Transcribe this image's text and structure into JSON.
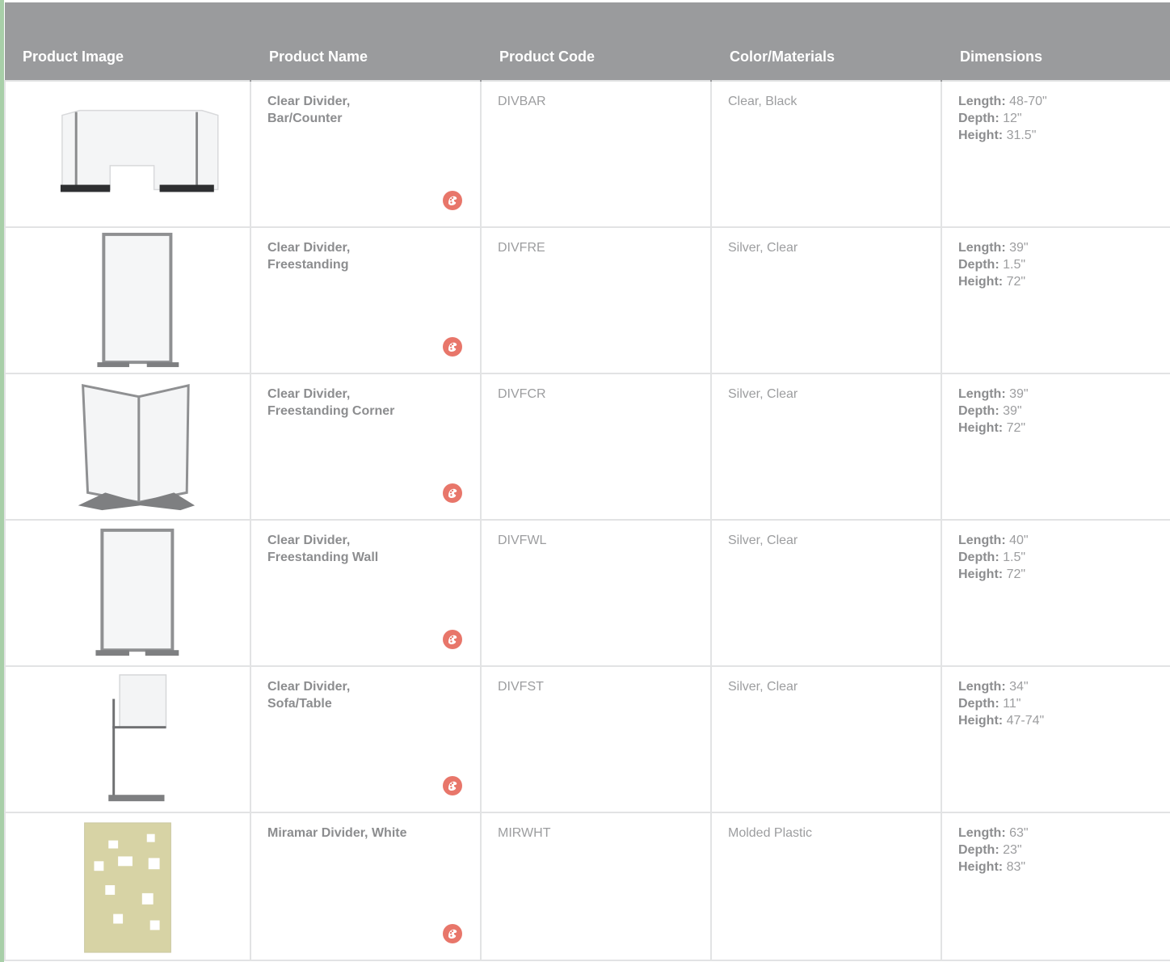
{
  "table": {
    "headers": [
      "Product Image",
      "Product Name",
      "Product Code",
      "Color/Materials",
      "Dimensions"
    ],
    "dim_labels": {
      "length": "Length:",
      "depth": "Depth:",
      "height": "Height:"
    },
    "rows": [
      {
        "name": "Clear Divider,\nBar/Counter",
        "code": "DIVBAR",
        "materials": "Clear, Black",
        "length": "48-70\"",
        "depth": "12\"",
        "height": "31.5\""
      },
      {
        "name": "Clear Divider,\nFreestanding",
        "code": "DIVFRE",
        "materials": "Silver, Clear",
        "length": "39\"",
        "depth": "1.5\"",
        "height": "72\""
      },
      {
        "name": "Clear Divider,\nFreestanding Corner",
        "code": "DIVFCR",
        "materials": "Silver, Clear",
        "length": "39\"",
        "depth": "39\"",
        "height": "72\""
      },
      {
        "name": "Clear Divider,\nFreestanding Wall",
        "code": "DIVFWL",
        "materials": "Silver, Clear",
        "length": "40\"",
        "depth": "1.5\"",
        "height": "72\""
      },
      {
        "name": "Clear Divider,\nSofa/Table",
        "code": "DIVFST",
        "materials": "Silver, Clear",
        "length": "34\"",
        "depth": "11\"",
        "height": "47-74\""
      },
      {
        "name": "Miramar Divider, White",
        "code": "MIRWHT",
        "materials": "Molded Plastic",
        "length": "63\"",
        "depth": "23\"",
        "height": "83\""
      }
    ]
  },
  "icons": {
    "palette": "palette-icon"
  },
  "colors": {
    "header_bg": "#9a9b9d",
    "accent_icon": "#e8766a",
    "left_rule": "#a8cfa8"
  }
}
